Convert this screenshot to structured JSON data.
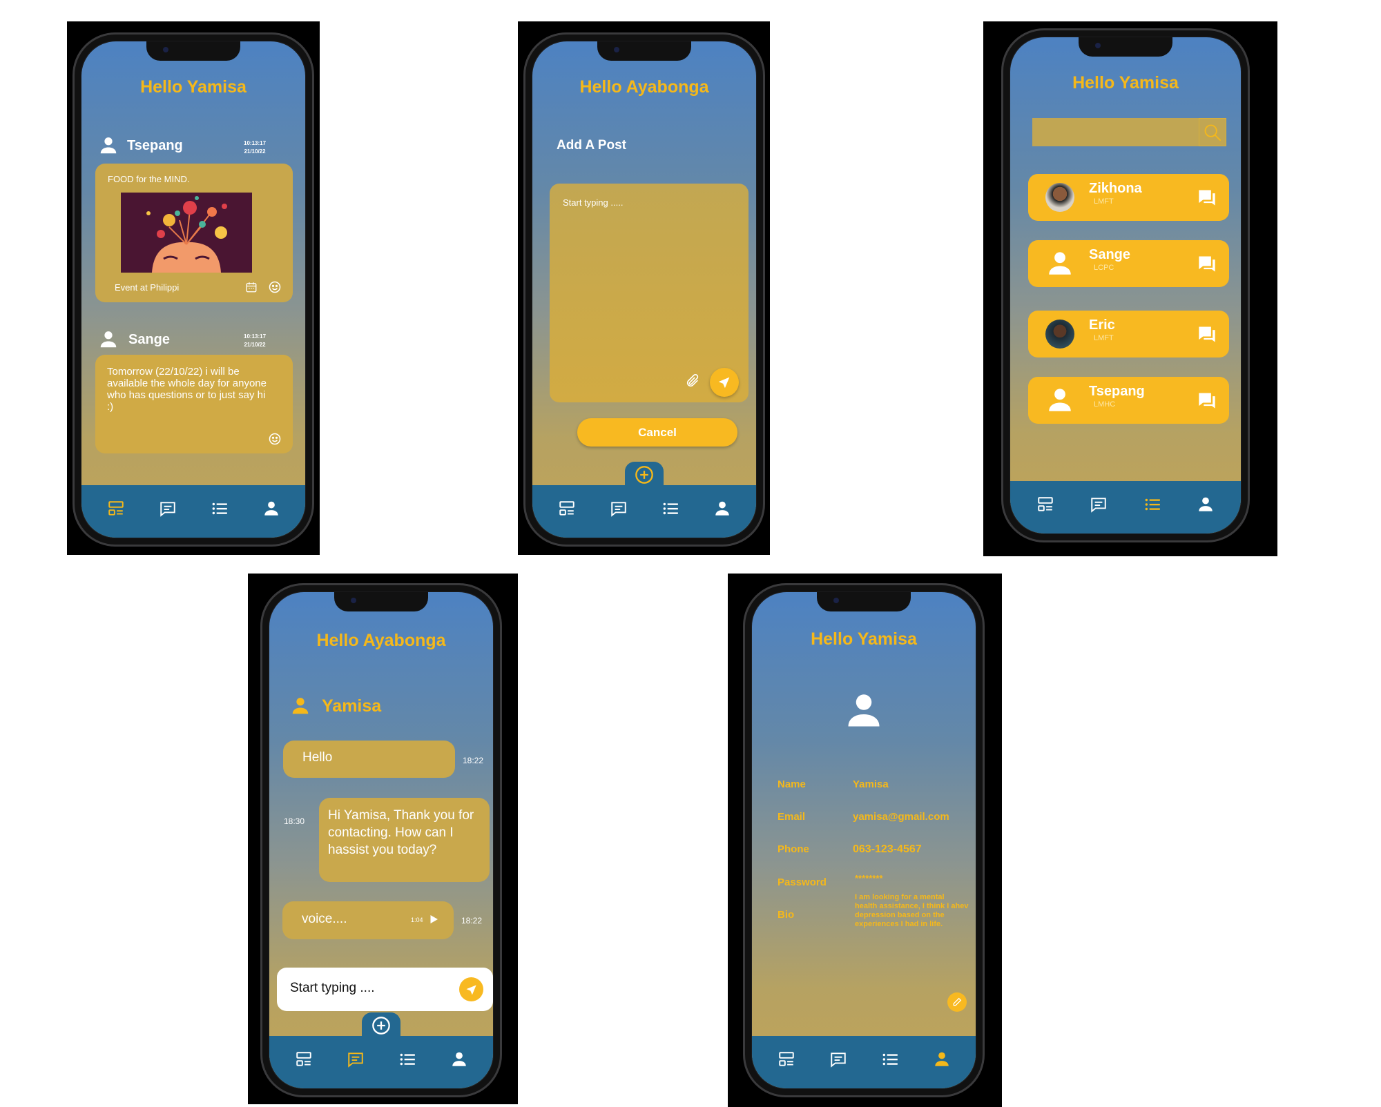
{
  "feed_screen": {
    "greeting": "Hello Yamisa",
    "posts": [
      {
        "author": "Tsepang",
        "time": "10:13:17",
        "date": "21/10/22",
        "text": "FOOD for the MIND.",
        "caption": "Event at Philippi"
      },
      {
        "author": "Sange",
        "time": "10:13:17",
        "date": "21/10/22",
        "text": "Tomorrow (22/10/22) i will be available the whole day for anyone who has questions or to just say hi :)"
      }
    ],
    "active_tab": "feed"
  },
  "add_post_screen": {
    "greeting": "Hello Ayabonga",
    "heading": "Add A Post",
    "placeholder": "Start typing .....",
    "cancel_label": "Cancel"
  },
  "counsellors_screen": {
    "greeting": "Hello Yamisa",
    "search_placeholder": "",
    "counsellors": [
      {
        "name": "Zikhona",
        "credential": "LMFT",
        "avatar": "photo"
      },
      {
        "name": "Sange",
        "credential": "LCPC",
        "avatar": "user-icon"
      },
      {
        "name": "Eric",
        "credential": "LMFT",
        "avatar": "photo"
      },
      {
        "name": "Tsepang",
        "credential": "LMHC",
        "avatar": "user-icon"
      }
    ],
    "active_tab": "list"
  },
  "chat_screen": {
    "greeting": "Hello Ayabonga",
    "contact": "Yamisa",
    "messages": [
      {
        "text": "Hello",
        "time": "18:22",
        "side": "left"
      },
      {
        "text": "Hi Yamisa, Thank you for  contacting. How can I hassist you today?",
        "time": "18:30",
        "side": "right"
      },
      {
        "text": "voice....",
        "duration": "1:04",
        "time": "18:22",
        "side": "left"
      }
    ],
    "input_placeholder": "Start typing ....",
    "active_tab": "chat"
  },
  "profile_screen": {
    "greeting": "Hello Yamisa",
    "fields": [
      {
        "label": "Name",
        "value": "Yamisa"
      },
      {
        "label": "Email",
        "value": "yamisa@gmail.com"
      },
      {
        "label": "Phone",
        "value": "063-123-4567"
      },
      {
        "label": "Password",
        "value": "********"
      },
      {
        "label": "Bio",
        "value": "I am looking for a mental health assistance, I think I ahev depression based on the experiences I had in life."
      }
    ],
    "active_tab": "profile"
  },
  "colors": {
    "accent": "#f5b81a",
    "card": "#c8a74c",
    "nav": "#236891",
    "gradient_top": "#4d82c2",
    "gradient_bottom": "#c2a456"
  }
}
